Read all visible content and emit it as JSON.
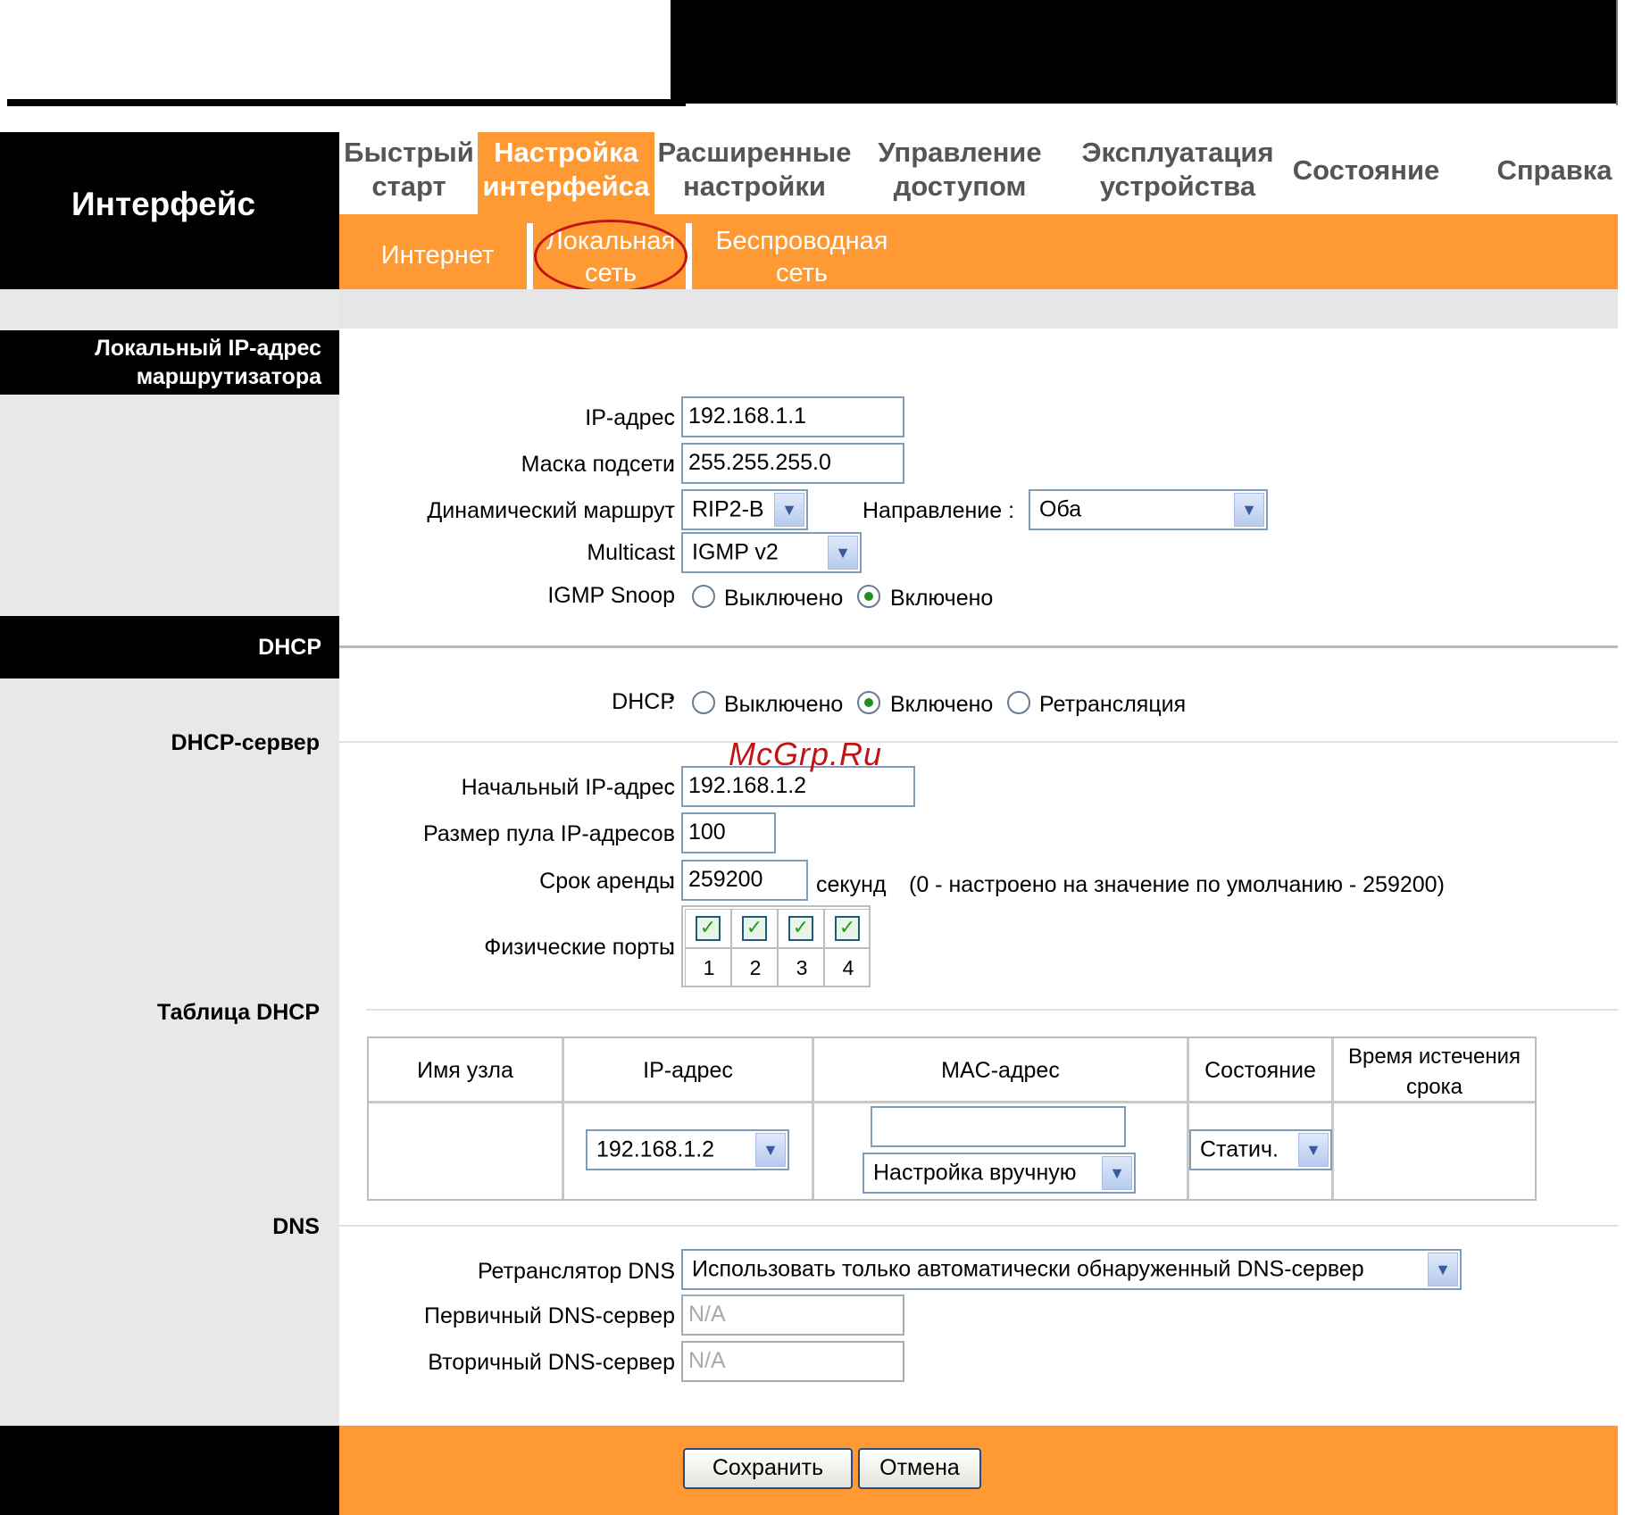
{
  "brand": "Интерфейс",
  "tabs": [
    {
      "line1": "Быстрый",
      "line2": "старт"
    },
    {
      "line1": "Настройка",
      "line2": "интерфейса",
      "active": true
    },
    {
      "line1": "Расширенные",
      "line2": "настройки"
    },
    {
      "line1": "Управление",
      "line2": "доступом"
    },
    {
      "line1": "Эксплуатация",
      "line2": "устройства"
    },
    {
      "line1": "Состояние",
      "line2": ""
    },
    {
      "line1": "Справка",
      "line2": ""
    }
  ],
  "subtabs": [
    {
      "line1": "Интернет",
      "line2": ""
    },
    {
      "line1": "Локальная",
      "line2": "сеть",
      "active": true
    },
    {
      "line1": "Беспроводная",
      "line2": "сеть"
    }
  ],
  "sections": {
    "router_ip_line1": "Локальный IP-адрес",
    "router_ip_line2": "маршрутизатора",
    "dhcp": "DHCP",
    "dhcp_server": "DHCP-сервер",
    "dhcp_table": "Таблица DHCP",
    "dns": "DNS"
  },
  "lan": {
    "ip_label": "IP-адрес",
    "ip_value": "192.168.1.1",
    "mask_label": "Маска подсети",
    "mask_value": "255.255.255.0",
    "route_label": "Динамический маршрут",
    "route_value": "RIP2-B",
    "direction_label": "Направление",
    "direction_value": "Оба",
    "multicast_label": "Multicast",
    "multicast_value": "IGMP v2",
    "igmp_label": "IGMP Snoop",
    "off": "Выключено",
    "on": "Включено",
    "igmp_selected": "on"
  },
  "dhcp": {
    "label": "DHCP",
    "off": "Выключено",
    "on": "Включено",
    "relay": "Ретрансляция",
    "selected": "on",
    "start_ip_label": "Начальный IP-адрес",
    "start_ip_value": "192.168.1.2",
    "pool_label": "Размер пула IP-адресов",
    "pool_value": "100",
    "lease_label": "Срок аренды",
    "lease_value": "259200",
    "lease_unit": "секунд",
    "lease_hint": "(0 - настроено на значение по умолчанию - 259200)",
    "ports_label": "Физические порты",
    "ports": [
      {
        "num": "1",
        "checked": true
      },
      {
        "num": "2",
        "checked": true
      },
      {
        "num": "3",
        "checked": true
      },
      {
        "num": "4",
        "checked": true
      }
    ]
  },
  "table": {
    "headers": {
      "host": "Имя узла",
      "ip": "IP-адрес",
      "mac": "MAC-адрес",
      "state": "Состояние",
      "expire_line1": "Время истечения",
      "expire_line2": "срока"
    },
    "row": {
      "ip_value": "192.168.1.2",
      "mac_value": "",
      "mac_mode": "Настройка вручную",
      "state_value": "Статич."
    }
  },
  "dns": {
    "relay_label": "Ретранслятор DNS",
    "relay_value": "Использовать только автоматически обнаруженный DNS-сервер",
    "primary_label": "Первичный DNS-сервер",
    "primary_value": "N/A",
    "secondary_label": "Вторичный DNS-сервер",
    "secondary_value": "N/A"
  },
  "buttons": {
    "save": "Сохранить",
    "cancel": "Отмена"
  },
  "watermark": "McGrp.Ru",
  "colors": {
    "accent": "#ff9933",
    "oval": "#c01414",
    "check": "#1f9a1f"
  }
}
